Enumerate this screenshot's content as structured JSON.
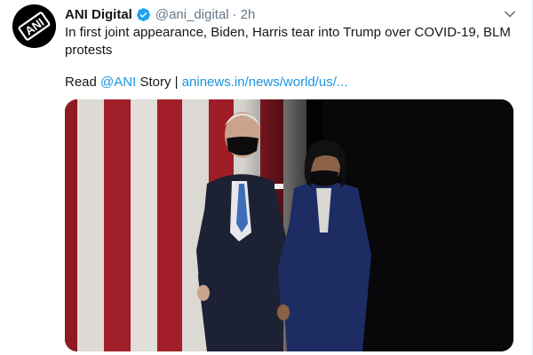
{
  "tweet": {
    "display_name": "ANI Digital",
    "handle": "@ani_digital",
    "separator": "·",
    "time": "2h",
    "text": "In first joint appearance, Biden, Harris tear into Trump over COVID-19, BLM protests",
    "read_prefix": "Read",
    "mention": "@ANI",
    "story_label": "Story |",
    "link_text": "aninews.in/news/world/us/..."
  },
  "colors": {
    "text": "#14171a",
    "secondary": "#657786",
    "link": "#1b95e0",
    "verified_badge": "#1da1f2"
  },
  "avatar": {
    "logo_text": "ANI"
  },
  "icons": {
    "verified": "verified-badge-icon",
    "menu": "chevron-down-icon"
  },
  "media": {
    "type": "photo"
  }
}
